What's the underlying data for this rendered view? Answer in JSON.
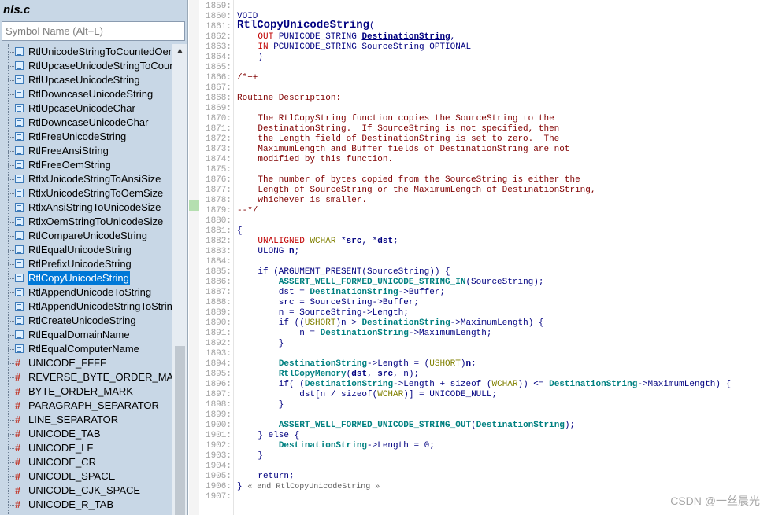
{
  "left_panel": {
    "file_title": "nls.c",
    "search_placeholder": "Symbol Name (Alt+L)",
    "items": [
      {
        "label": "RtlUnicodeStringToCountedOemString",
        "icon": "function-icon"
      },
      {
        "label": "RtlUpcaseUnicodeStringToCountedOemString",
        "icon": "function-icon"
      },
      {
        "label": "RtlUpcaseUnicodeString",
        "icon": "function-icon"
      },
      {
        "label": "RtlDowncaseUnicodeString",
        "icon": "function-icon"
      },
      {
        "label": "RtlUpcaseUnicodeChar",
        "icon": "function-icon"
      },
      {
        "label": "RtlDowncaseUnicodeChar",
        "icon": "function-icon"
      },
      {
        "label": "RtlFreeUnicodeString",
        "icon": "function-icon"
      },
      {
        "label": "RtlFreeAnsiString",
        "icon": "function-icon"
      },
      {
        "label": "RtlFreeOemString",
        "icon": "function-icon"
      },
      {
        "label": "RtlxUnicodeStringToAnsiSize",
        "icon": "function-icon"
      },
      {
        "label": "RtlxUnicodeStringToOemSize",
        "icon": "function-icon"
      },
      {
        "label": "RtlxAnsiStringToUnicodeSize",
        "icon": "function-icon"
      },
      {
        "label": "RtlxOemStringToUnicodeSize",
        "icon": "function-icon"
      },
      {
        "label": "RtlCompareUnicodeString",
        "icon": "function-icon"
      },
      {
        "label": "RtlEqualUnicodeString",
        "icon": "function-icon"
      },
      {
        "label": "RtlPrefixUnicodeString",
        "icon": "function-icon"
      },
      {
        "label": "RtlCopyUnicodeString",
        "icon": "function-icon",
        "selected": true
      },
      {
        "label": "RtlAppendUnicodeToString",
        "icon": "function-icon"
      },
      {
        "label": "RtlAppendUnicodeStringToString",
        "icon": "function-icon"
      },
      {
        "label": "RtlCreateUnicodeString",
        "icon": "function-icon"
      },
      {
        "label": "RtlEqualDomainName",
        "icon": "function-icon"
      },
      {
        "label": "RtlEqualComputerName",
        "icon": "function-icon"
      },
      {
        "label": "UNICODE_FFFF",
        "icon": "macro-icon"
      },
      {
        "label": "REVERSE_BYTE_ORDER_MARK",
        "icon": "macro-icon"
      },
      {
        "label": "BYTE_ORDER_MARK",
        "icon": "macro-icon"
      },
      {
        "label": "PARAGRAPH_SEPARATOR",
        "icon": "macro-icon"
      },
      {
        "label": "LINE_SEPARATOR",
        "icon": "macro-icon"
      },
      {
        "label": "UNICODE_TAB",
        "icon": "macro-icon"
      },
      {
        "label": "UNICODE_LF",
        "icon": "macro-icon"
      },
      {
        "label": "UNICODE_CR",
        "icon": "macro-icon"
      },
      {
        "label": "UNICODE_SPACE",
        "icon": "macro-icon"
      },
      {
        "label": "UNICODE_CJK_SPACE",
        "icon": "macro-icon"
      },
      {
        "label": "UNICODE_R_TAB",
        "icon": "macro-icon"
      }
    ]
  },
  "code": {
    "line_numbers": [
      "1859:",
      "1860:",
      "1861:",
      "1862:",
      "1863:",
      "1864:",
      "1865:",
      "1866:",
      "1867:",
      "1868:",
      "1869:",
      "1870:",
      "1871:",
      "1872:",
      "1873:",
      "1874:",
      "1875:",
      "1876:",
      "1877:",
      "1878:",
      "1879:",
      "1880:",
      "1881:",
      "1882:",
      "1883:",
      "1884:",
      "1885:",
      "1886:",
      "1887:",
      "1888:",
      "1889:",
      "1890:",
      "1891:",
      "1892:",
      "1893:",
      "1894:",
      "1895:",
      "1896:",
      "1897:",
      "1898:",
      "1899:",
      "1900:",
      "1901:",
      "1902:",
      "1903:",
      "1904:",
      "1905:",
      "1906:",
      "1907:"
    ],
    "lines": [
      "",
      "VOID",
      "RtlCopyUnicodeString(",
      "    OUT PUNICODE_STRING DestinationString,",
      "    IN PCUNICODE_STRING SourceString OPTIONAL",
      "    )",
      "",
      "/*++",
      "",
      "Routine Description:",
      "",
      "    The RtlCopyString function copies the SourceString to the",
      "    DestinationString.  If SourceString is not specified, then",
      "    the Length field of DestinationString is set to zero.  The",
      "    MaximumLength and Buffer fields of DestinationString are not",
      "    modified by this function.",
      "",
      "    The number of bytes copied from the SourceString is either the",
      "    Length of SourceString or the MaximumLength of DestinationString,",
      "    whichever is smaller.",
      "--*/",
      "",
      "{",
      "    UNALIGNED WCHAR *src, *dst;",
      "    ULONG n;",
      "",
      "    if (ARGUMENT_PRESENT(SourceString)) {",
      "        ASSERT_WELL_FORMED_UNICODE_STRING_IN(SourceString);",
      "        dst = DestinationString->Buffer;",
      "        src = SourceString->Buffer;",
      "        n = SourceString->Length;",
      "        if ((USHORT)n > DestinationString->MaximumLength) {",
      "            n = DestinationString->MaximumLength;",
      "        }",
      "",
      "        DestinationString->Length = (USHORT)n;",
      "        RtlCopyMemory(dst, src, n);",
      "        if( (DestinationString->Length + sizeof (WCHAR)) <= DestinationString->MaximumLength) {",
      "            dst[n / sizeof(WCHAR)] = UNICODE_NULL;",
      "        }",
      "",
      "        ASSERT_WELL_FORMED_UNICODE_STRING_OUT(DestinationString);",
      "    } else {",
      "        DestinationString->Length = 0;",
      "    }",
      "",
      "    return;",
      "} « end RtlCopyUnicodeString »",
      ""
    ]
  },
  "watermark": "CSDN @一丝晨光"
}
